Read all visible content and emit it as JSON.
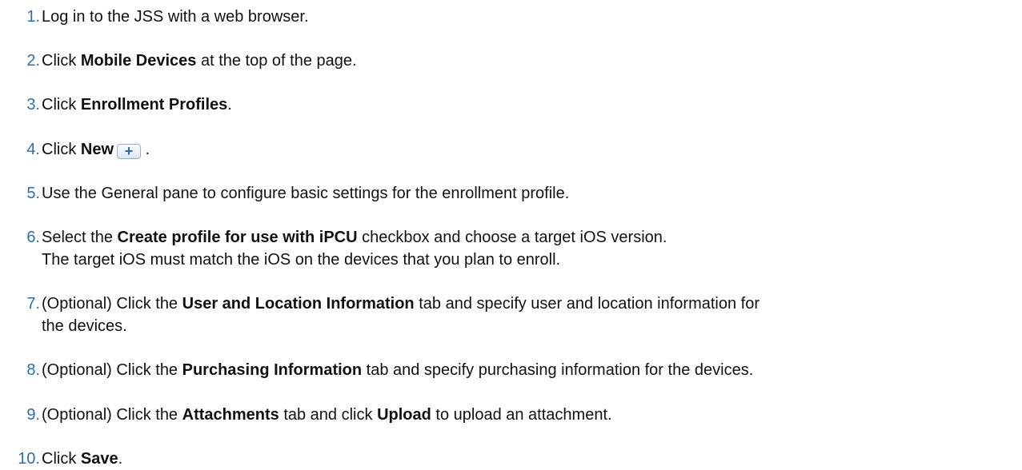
{
  "steps": [
    {
      "num": "1.",
      "parts": [
        "Log in to the JSS with a web browser."
      ]
    },
    {
      "num": "2.",
      "pre": "Click ",
      "bold": "Mobile Devices",
      "post": " at the top of the page."
    },
    {
      "num": "3.",
      "pre": "Click ",
      "bold": "Enrollment Profiles",
      "post": "."
    },
    {
      "num": "4.",
      "pre": "Click ",
      "bold": "New",
      "icon_glyph": "+",
      "icon_name": "plus-icon",
      "post": " ."
    },
    {
      "num": "5.",
      "parts": [
        "Use the General pane to configure basic settings for the enrollment profile."
      ]
    },
    {
      "num": "6.",
      "pre": "Select the ",
      "bold": "Create profile for use with iPCU",
      "post": " checkbox and choose a target iOS version.",
      "line2": "The target iOS must match the iOS on the devices that you plan to enroll."
    },
    {
      "num": "7.",
      "pre": "(Optional) Click the ",
      "bold": "User and Location Information",
      "post": " tab and specify user and location information for",
      "line2": "the devices."
    },
    {
      "num": "8.",
      "pre": "(Optional) Click the ",
      "bold": "Purchasing Information",
      "post": " tab and specify purchasing information for the devices."
    },
    {
      "num": "9.",
      "pre": "(Optional) Click the ",
      "bold": "Attachments",
      "mid": " tab and click ",
      "bold2": "Upload",
      "post": " to upload an attachment."
    },
    {
      "num": "10.",
      "pre": "Click ",
      "bold": "Save",
      "post": "."
    }
  ]
}
